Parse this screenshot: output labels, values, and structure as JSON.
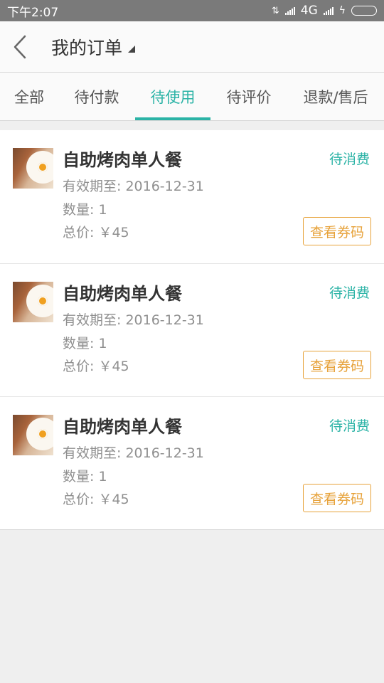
{
  "status_bar": {
    "time": "下午2:07",
    "network": "4G"
  },
  "header": {
    "title": "我的订单",
    "back_icon": "chevron-left-icon"
  },
  "tabs": [
    {
      "label": "全部",
      "active": false
    },
    {
      "label": "待付款",
      "active": false
    },
    {
      "label": "待使用",
      "active": true
    },
    {
      "label": "待评价",
      "active": false
    },
    {
      "label": "退款/售后",
      "active": false
    }
  ],
  "colors": {
    "accent": "#2bb3a6",
    "voucher": "#e7a23a",
    "status_bar_bg": "#7a7a7a"
  },
  "orders": [
    {
      "name": "自助烤肉单人餐",
      "status": "待消费",
      "valid_until": "有效期至: 2016-12-31",
      "quantity": "数量: 1",
      "total_price": "总价: ￥45",
      "voucher_button": "查看券码"
    },
    {
      "name": "自助烤肉单人餐",
      "status": "待消费",
      "valid_until": "有效期至: 2016-12-31",
      "quantity": "数量: 1",
      "total_price": "总价: ￥45",
      "voucher_button": "查看券码"
    },
    {
      "name": "自助烤肉单人餐",
      "status": "待消费",
      "valid_until": "有效期至: 2016-12-31",
      "quantity": "数量: 1",
      "total_price": "总价: ￥45",
      "voucher_button": "查看券码"
    }
  ]
}
